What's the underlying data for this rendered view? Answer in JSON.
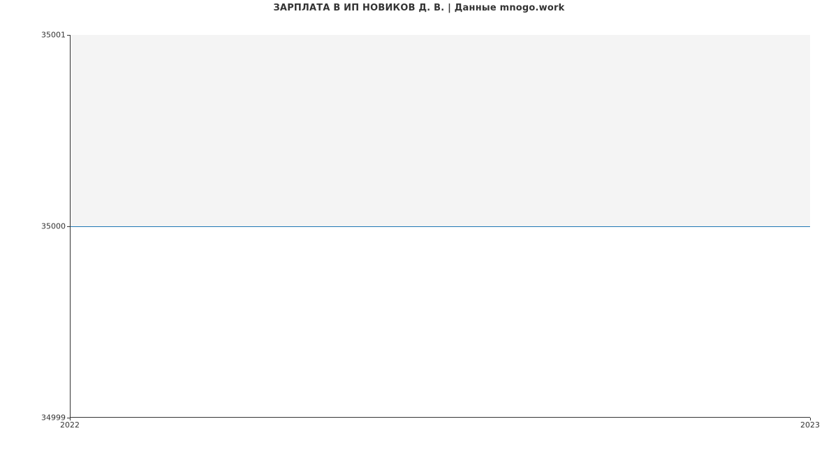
{
  "chart_data": {
    "type": "line",
    "title": "ЗАРПЛАТА В ИП НОВИКОВ Д. В. | Данные mnogo.work",
    "x": [
      "2022",
      "2023"
    ],
    "series": [
      {
        "name": "salary",
        "values": [
          35000,
          35000
        ],
        "color": "#1f77b4"
      }
    ],
    "xlabel": "",
    "ylabel": "",
    "ylim": [
      34999,
      35001
    ],
    "yticks": [
      34999,
      35000,
      35001
    ],
    "xticks": [
      "2022",
      "2023"
    ]
  }
}
